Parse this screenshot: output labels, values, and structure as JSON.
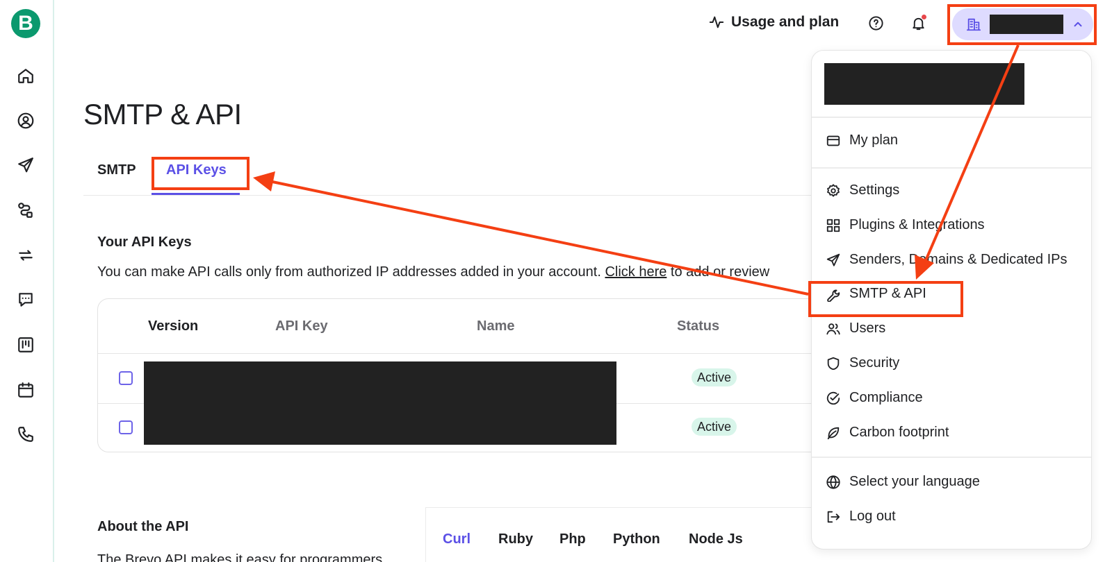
{
  "sidebar": {
    "logo_letter": "B",
    "icons": [
      "home-icon",
      "contacts-icon",
      "campaigns-icon",
      "automations-icon",
      "transactional-icon",
      "conversations-icon",
      "deals-icon",
      "meetings-icon",
      "phone-icon"
    ]
  },
  "header": {
    "usage_label": "Usage and plan",
    "help_icon": "help-icon",
    "notifications_icon": "bell-icon",
    "account_icon": "building-icon",
    "account_name": "",
    "account_chevron": "chevron-up-icon"
  },
  "page": {
    "title": "SMTP & API",
    "tabs": [
      {
        "label": "SMTP"
      },
      {
        "label": "API Keys",
        "active": true
      }
    ]
  },
  "api_keys": {
    "title": "Your API Keys",
    "description": "You can make API calls only from authorized IP addresses added in your account. ",
    "link_text": "Click here",
    "description_tail": " to add or review",
    "columns": [
      "Version",
      "API Key",
      "Name",
      "Status"
    ],
    "rows": [
      {
        "status": "Active"
      },
      {
        "status": "Active"
      }
    ]
  },
  "about": {
    "title": "About the API",
    "description": "The Brevo API makes it easy for programmers",
    "code_tabs": [
      "Curl",
      "Ruby",
      "Php",
      "Python",
      "Node Js"
    ]
  },
  "dropdown": {
    "items": [
      {
        "label": "My plan",
        "icon": "card-icon"
      },
      {
        "label": "Settings",
        "icon": "gear-icon"
      },
      {
        "label": "Plugins & Integrations",
        "icon": "grid-icon"
      },
      {
        "label": "Senders, Domains & Dedicated IPs",
        "icon": "send-icon"
      },
      {
        "label": "SMTP & API",
        "icon": "wrench-icon"
      },
      {
        "label": "Users",
        "icon": "users-icon"
      },
      {
        "label": "Security",
        "icon": "shield-icon"
      },
      {
        "label": "Compliance",
        "icon": "check-circle-icon"
      },
      {
        "label": "Carbon footprint",
        "icon": "leaf-icon"
      },
      {
        "label": "Select your language",
        "icon": "globe-icon"
      },
      {
        "label": "Log out",
        "icon": "logout-icon"
      }
    ]
  },
  "colors": {
    "accent": "#5b50e6",
    "brand": "#0b996e",
    "annotation": "#f43f13",
    "badge_bg": "#d8f5ea"
  }
}
